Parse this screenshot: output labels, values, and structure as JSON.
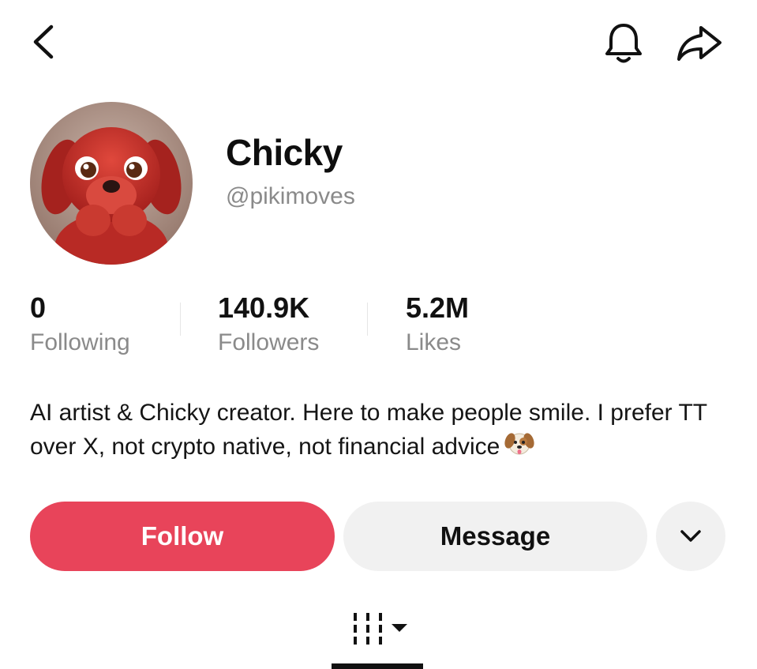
{
  "header": {
    "back_icon": "chevron-left-icon",
    "bell_icon": "bell-icon",
    "share_icon": "share-arrow-icon"
  },
  "profile": {
    "avatar_desc": "red-puppy-avatar",
    "name": "Chicky",
    "handle": "@pikimoves"
  },
  "stats": [
    {
      "value": "0",
      "label": "Following"
    },
    {
      "value": "140.9K",
      "label": "Followers"
    },
    {
      "value": "5.2M",
      "label": "Likes"
    }
  ],
  "bio": {
    "text": "AI artist & Chicky creator. Here to make people smile. I prefer TT over X, not crypto native, not financial advice",
    "emoji_icon": "dog-face-emoji"
  },
  "actions": {
    "follow_label": "Follow",
    "message_label": "Message",
    "more_icon": "chevron-down-icon"
  },
  "tabs": {
    "grid_icon": "grid-icon",
    "dropdown_icon": "caret-down-icon"
  },
  "colors": {
    "follow_bg": "#e8445a",
    "secondary_btn_bg": "#f1f1f1",
    "muted_text": "#8a8a8a"
  }
}
